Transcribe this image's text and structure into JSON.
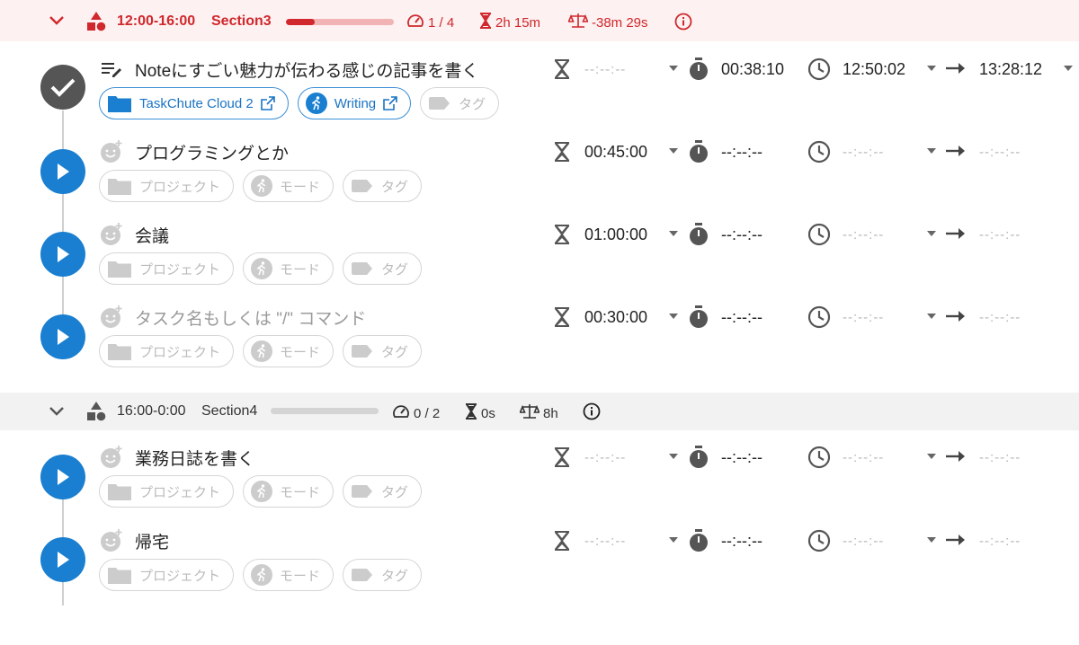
{
  "sections": [
    {
      "time_range": "12:00-16:00",
      "name": "Section3",
      "progress": 0.27,
      "count": "1 / 4",
      "estimate": "2h 15m",
      "balance": "-38m 29s"
    },
    {
      "time_range": "16:00-0:00",
      "name": "Section4",
      "progress": 0,
      "count": "0 / 2",
      "estimate": "0s",
      "balance": "8h"
    }
  ],
  "tasks": [
    {
      "title": "Noteにすごい魅力が伝わる感じの記事を書く",
      "status": "done",
      "estimate": "--:--:--",
      "actual": "00:38:10",
      "start": "12:50:02",
      "end": "13:28:12",
      "project": "TaskChute Cloud 2",
      "mode": "Writing",
      "tag": "タグ"
    },
    {
      "title": "プログラミングとか",
      "status": "play",
      "estimate": "00:45:00",
      "actual": "--:--:--",
      "start": "--:--:--",
      "end": "--:--:--",
      "project": "プロジェクト",
      "mode": "モード",
      "tag": "タグ"
    },
    {
      "title": "会議",
      "status": "play",
      "estimate": "01:00:00",
      "actual": "--:--:--",
      "start": "--:--:--",
      "end": "--:--:--",
      "project": "プロジェクト",
      "mode": "モード",
      "tag": "タグ"
    },
    {
      "title": "",
      "placeholder": "タスク名もしくは \"/\" コマンド",
      "status": "play",
      "estimate": "00:30:00",
      "actual": "--:--:--",
      "start": "--:--:--",
      "end": "--:--:--",
      "project": "プロジェクト",
      "mode": "モード",
      "tag": "タグ"
    },
    {
      "title": "業務日誌を書く",
      "status": "play",
      "estimate": "--:--:--",
      "actual": "--:--:--",
      "start": "--:--:--",
      "end": "--:--:--",
      "project": "プロジェクト",
      "mode": "モード",
      "tag": "タグ"
    },
    {
      "title": "帰宅",
      "status": "play",
      "estimate": "--:--:--",
      "actual": "--:--:--",
      "start": "--:--:--",
      "end": "--:--:--",
      "project": "プロジェクト",
      "mode": "モード",
      "tag": "タグ"
    }
  ],
  "colors": {
    "accent_red": "#d0282c",
    "play_blue": "#1a7fd0",
    "done_gray": "#555555"
  },
  "icons": {
    "section_collapse": "chevron-down-icon",
    "section_shapes": "shapes-icon",
    "speedometer": "speedometer-icon",
    "hourglass": "hourglass-icon",
    "scale": "scale-icon",
    "info": "info-icon",
    "stopwatch": "stopwatch-icon",
    "clock": "clock-icon",
    "arrow": "arrow-right-icon"
  }
}
